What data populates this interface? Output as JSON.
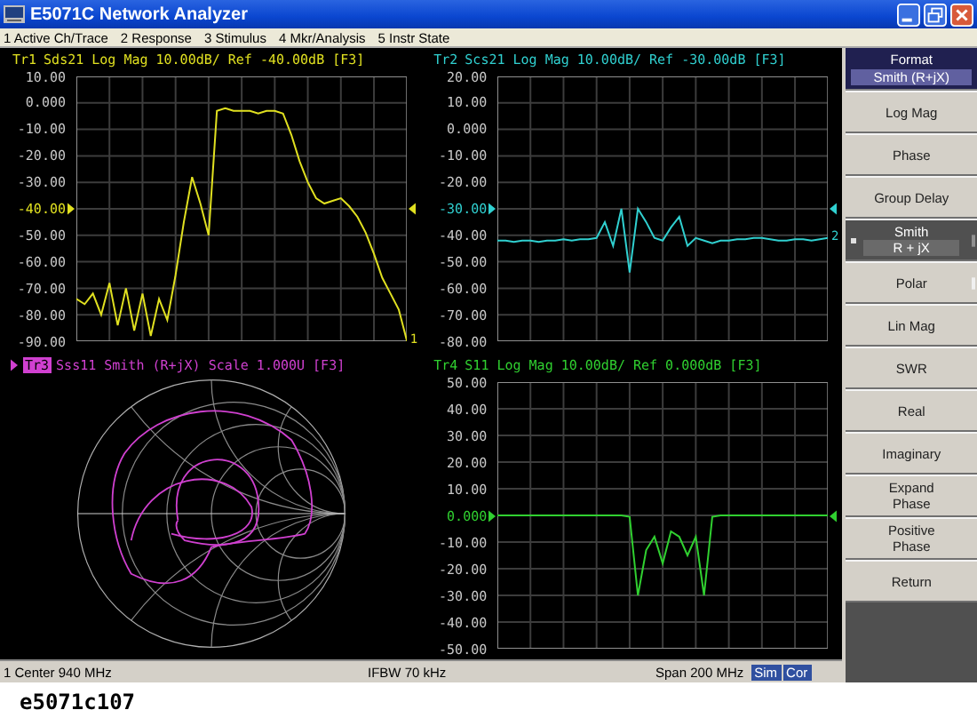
{
  "window": {
    "title": "E5071C Network Analyzer"
  },
  "menu": [
    "1 Active Ch/Trace",
    "2 Response",
    "3 Stimulus",
    "4 Mkr/Analysis",
    "5 Instr State"
  ],
  "traces": [
    {
      "kind": "logmag",
      "label": "Tr1",
      "title": "Sds21 Log Mag 10.00dB/ Ref -40.00dB [F3]",
      "active": false,
      "color": "#e0e020",
      "end_label": "1",
      "chart_data": {
        "type": "line",
        "ylim": [
          -90,
          10
        ],
        "yticks": [
          {
            "value": 10,
            "label": "10.00"
          },
          {
            "value": 0,
            "label": "0.000"
          },
          {
            "value": -10,
            "label": "-10.00"
          },
          {
            "value": -20,
            "label": "-20.00"
          },
          {
            "value": -30,
            "label": "-30.00"
          },
          {
            "value": -40,
            "label": "-40.00"
          },
          {
            "value": -50,
            "label": "-50.00"
          },
          {
            "value": -60,
            "label": "-60.00"
          },
          {
            "value": -70,
            "label": "-70.00"
          },
          {
            "value": -80,
            "label": "-80.00"
          },
          {
            "value": -90,
            "label": "-90.00"
          }
        ],
        "series": [
          {
            "color": "#e0e020",
            "values": [
              -74,
              -76,
              -72,
              -80,
              -68,
              -84,
              -70,
              -86,
              -72,
              -88,
              -74,
              -82,
              -65,
              -45,
              -28,
              -38,
              -50,
              -3,
              -2,
              -3,
              -3,
              -3,
              -4,
              -3,
              -3,
              -4,
              -12,
              -22,
              -30,
              -36,
              -38,
              -37,
              -36,
              -39,
              -43,
              -49,
              -57,
              -66,
              -72,
              -78,
              -90
            ]
          }
        ],
        "grid": true
      },
      "ref_marks": [
        false,
        false,
        false,
        false,
        false,
        true,
        false,
        false,
        false,
        false,
        false
      ]
    },
    {
      "kind": "logmag",
      "label": "Tr2",
      "title": "Scs21 Log Mag 10.00dB/ Ref -30.00dB [F3]",
      "active": false,
      "color": "#30d0d0",
      "end_label": "2",
      "chart_data": {
        "type": "line",
        "ylim": [
          -80,
          20
        ],
        "yticks": [
          {
            "value": 20,
            "label": "20.00"
          },
          {
            "value": 10,
            "label": "10.00"
          },
          {
            "value": 0,
            "label": "0.000"
          },
          {
            "value": -10,
            "label": "-10.00"
          },
          {
            "value": -20,
            "label": "-20.00"
          },
          {
            "value": -30,
            "label": "-30.00"
          },
          {
            "value": -40,
            "label": "-40.00"
          },
          {
            "value": -50,
            "label": "-50.00"
          },
          {
            "value": -60,
            "label": "-60.00"
          },
          {
            "value": -70,
            "label": "-70.00"
          },
          {
            "value": -80,
            "label": "-80.00"
          }
        ],
        "series": [
          {
            "color": "#30d0d0",
            "values": [
              -42,
              -42,
              -42.5,
              -42,
              -42,
              -42.5,
              -42,
              -42,
              -41.5,
              -42,
              -41.5,
              -41.5,
              -41,
              -35,
              -44,
              -30,
              -54,
              -30,
              -35,
              -41,
              -42,
              -37,
              -33,
              -44,
              -41,
              -42,
              -43,
              -42,
              -42,
              -41.5,
              -41.5,
              -41,
              -41,
              -41.5,
              -42,
              -42,
              -41.5,
              -41.5,
              -42,
              -41.5,
              -41
            ]
          }
        ],
        "grid": true
      },
      "ref_marks": [
        false,
        false,
        false,
        false,
        false,
        true,
        false,
        false,
        false,
        false,
        false
      ]
    },
    {
      "kind": "smith",
      "label": "Tr3",
      "title": "Sss11 Smith (R+jX) Scale 1.000U [F3]",
      "active": true,
      "color": "#d040d0"
    },
    {
      "kind": "logmag",
      "label": "Tr4",
      "title": "S11 Log Mag 10.00dB/ Ref 0.000dB [F3]",
      "active": false,
      "color": "#30d030",
      "chart_data": {
        "type": "line",
        "ylim": [
          -50,
          50
        ],
        "yticks": [
          {
            "value": 50,
            "label": "50.00"
          },
          {
            "value": 40,
            "label": "40.00"
          },
          {
            "value": 30,
            "label": "30.00"
          },
          {
            "value": 20,
            "label": "20.00"
          },
          {
            "value": 10,
            "label": "10.00"
          },
          {
            "value": 0,
            "label": "0.000"
          },
          {
            "value": -10,
            "label": "-10.00"
          },
          {
            "value": -20,
            "label": "-20.00"
          },
          {
            "value": -30,
            "label": "-30.00"
          },
          {
            "value": -40,
            "label": "-40.00"
          },
          {
            "value": -50,
            "label": "-50.00"
          }
        ],
        "series": [
          {
            "color": "#30d030",
            "values": [
              0,
              0,
              0,
              0,
              0,
              0,
              0,
              0,
              0,
              0,
              0,
              0,
              0,
              0,
              0,
              0,
              -0.5,
              -30,
              -13,
              -8,
              -18,
              -6,
              -8,
              -15,
              -8,
              -30,
              -0.5,
              0,
              0,
              0,
              0,
              0,
              0,
              0,
              0,
              0,
              0,
              0,
              0,
              0,
              0
            ]
          }
        ],
        "grid": true
      },
      "ref_marks": [
        false,
        false,
        false,
        false,
        false,
        true,
        false,
        false,
        false,
        false,
        false
      ]
    }
  ],
  "status_bar": {
    "center": "1 Center 940 MHz",
    "ifbw": "IFBW 70 kHz",
    "span": "Span 200 MHz",
    "badges": [
      "Sim",
      "Cor"
    ]
  },
  "softkeys": {
    "header": "Format",
    "value": "Smith (R+jX)",
    "items": [
      {
        "label": "Log Mag",
        "selected": false,
        "submenu": false
      },
      {
        "label": "Phase",
        "selected": false,
        "submenu": false
      },
      {
        "label": "Group Delay",
        "selected": false,
        "submenu": false
      },
      {
        "label": "Smith",
        "sub": "R + jX",
        "selected": true,
        "submenu": true
      },
      {
        "label": "Polar",
        "selected": false,
        "submenu": true
      },
      {
        "label": "Lin Mag",
        "selected": false,
        "submenu": false
      },
      {
        "label": "SWR",
        "selected": false,
        "submenu": false
      },
      {
        "label": "Real",
        "selected": false,
        "submenu": false
      },
      {
        "label": "Imaginary",
        "selected": false,
        "submenu": false
      },
      {
        "label": "Expand\nPhase",
        "selected": false,
        "submenu": false
      },
      {
        "label": "Positive\nPhase",
        "selected": false,
        "submenu": false
      },
      {
        "label": "Return",
        "selected": false,
        "submenu": false
      }
    ]
  },
  "caption": "e5071c107"
}
